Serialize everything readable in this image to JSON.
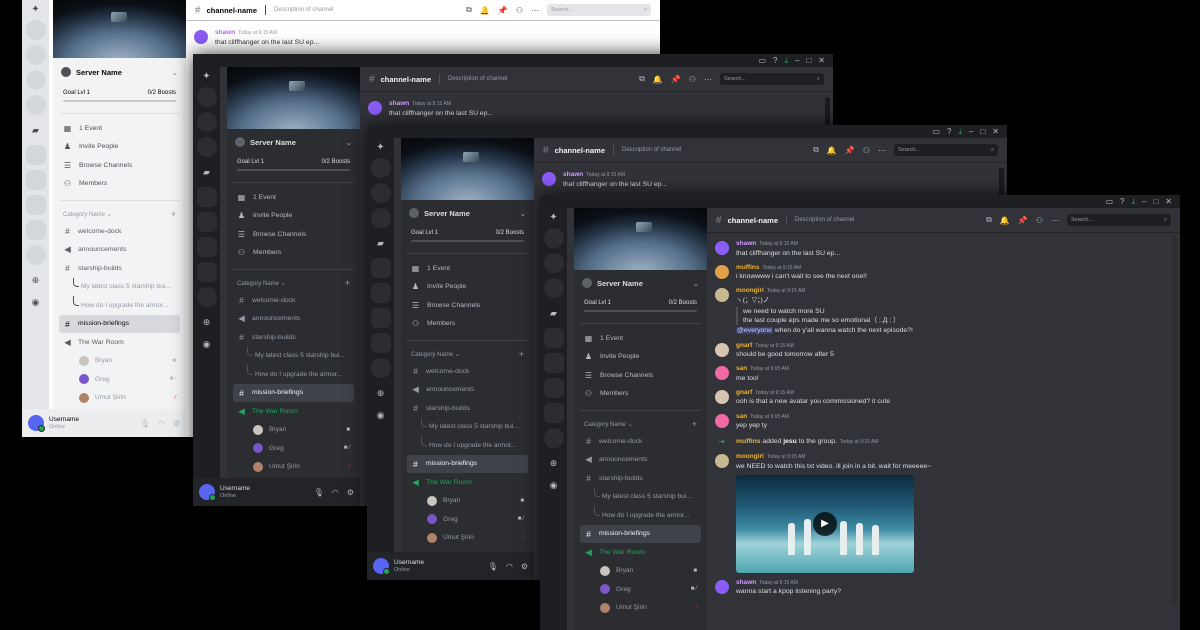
{
  "server": {
    "name": "Server Name",
    "goal": "Goal Lvl 1",
    "boosts": "0/2 Boosts"
  },
  "menu": [
    {
      "icon": "calendar-icon",
      "glyph": "▦",
      "label": "1 Event"
    },
    {
      "icon": "invite-people-icon",
      "glyph": "♟",
      "label": "Invite People"
    },
    {
      "icon": "browse-channels-icon",
      "glyph": "☰",
      "label": "Browse Channels"
    },
    {
      "icon": "members-icon",
      "glyph": "⚇",
      "label": "Members"
    }
  ],
  "category": "Category Name",
  "channels": {
    "welcome": "welcome-dock",
    "announcements": "announcements",
    "starship": "starship-builds",
    "thread1": "My latest class 5 starship bui...",
    "thread2": "How do I upgrade the armor...",
    "briefings": "mission-briefings",
    "voice": "The War Room"
  },
  "voice_users": [
    {
      "name": "Bryan",
      "color": "#c9c4bd"
    },
    {
      "name": "Greg",
      "color": "#7a56c8"
    },
    {
      "name": "Umut Şirin",
      "color": "#b0836a"
    }
  ],
  "user": {
    "name": "Username",
    "status": "Online"
  },
  "header": {
    "channel": "channel-name",
    "description": "Description of channel",
    "search_placeholder": "Search..."
  },
  "messages": [
    {
      "author": "shawn",
      "color": "#d29bff",
      "time": "Today at 9:15 AM",
      "text": "that cliffhanger on the last SU ep...",
      "avatar": "#8b5cf6"
    },
    {
      "author": "muffins",
      "color": "#f0b232",
      "time": "Today at 9:15 AM",
      "text": "i knowwww i can't wait to see the next one!!",
      "avatar": "#e0a14a"
    },
    {
      "author": "moongirl",
      "color": "#f0b232",
      "time": "Today at 9:15 AM",
      "text": "ヽ(；▽；)ノ",
      "quote1": "we need to watch more SU",
      "quote2": "the last couple eps made me so emotional（ ; Д ; ）",
      "mention": "@everyone",
      "after_mention": " when do y'all wanna watch the next episode?!",
      "avatar": "#c8b890"
    },
    {
      "author": "gnarf",
      "color": "#f0b232",
      "time": "Today at 9:15 AM",
      "text": "should be good tomorrow after 5",
      "avatar": "#d8c4b0"
    },
    {
      "author": "san",
      "color": "#f0b232",
      "time": "Today at 9:15 AM",
      "text": "me too!",
      "avatar": "#f06aa6"
    },
    {
      "author": "gnarf",
      "color": "#f0b232",
      "time": "Today at 9:15 AM",
      "text": "ooh is that a new avatar you commissioned? it cute",
      "avatar": "#d8c4b0"
    },
    {
      "author": "san",
      "color": "#f0b232",
      "time": "Today at 9:15 AM",
      "text": "yep yep ty",
      "avatar": "#f06aa6"
    },
    {
      "author": "moongirl",
      "color": "#f0b232",
      "time": "Today at 9:15 AM",
      "text": "we NEED to watch this txt video. ill join in a bit. wait for meeeee~",
      "avatar": "#c8b890"
    },
    {
      "author": "shawn",
      "color": "#d29bff",
      "time": "Today at 9:15 AM",
      "text": "wanna start a kpop listening party?",
      "avatar": "#8b5cf6"
    }
  ],
  "system": {
    "actor": "muffins",
    "action": " added ",
    "target": "jesu",
    "rest": " to the group.",
    "time": "Today at 9:15 AM"
  }
}
